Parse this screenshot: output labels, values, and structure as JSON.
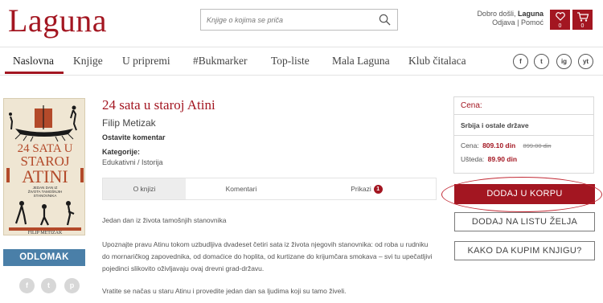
{
  "header": {
    "logo": "Laguna",
    "search_placeholder": "Knjige o kojima se priča",
    "greeting_prefix": "Dobro došli,",
    "greeting_brand": "Laguna",
    "account_links": "Odjava | Pomoć",
    "wishlist_count": "0",
    "cart_count": "0"
  },
  "nav": {
    "items": [
      "Naslovna",
      "Knjige",
      "U pripremi",
      "#Bukmarker",
      "Top-liste",
      "Mala Laguna",
      "Klub čitalaca"
    ],
    "active": "Naslovna",
    "social": [
      "f",
      "t",
      "ig",
      "yt"
    ]
  },
  "book": {
    "cover": {
      "line1": "24 SATA U",
      "line2": "STAROJ",
      "line3": "ATINI",
      "subtitle1": "JEDAN DAN IZ",
      "subtitle2": "ŽIVOTA TAMOŠNJIH",
      "subtitle3": "STANOVNIKA",
      "author": "FILIP METIZAK"
    },
    "title": "24 sata u staroj Atini",
    "author": "Filip Metizak",
    "comment_link": "Ostavite komentar",
    "categories_label": "Kategorije:",
    "categories": "Edukativni / Istorija",
    "excerpt_button": "ODLOMAK"
  },
  "tabs": {
    "items": [
      "O knjizi",
      "Komentari",
      "Prikazi"
    ],
    "reviews_badge": "1"
  },
  "description": [
    "Jedan dan iz života tamošnjih stanovnika",
    "Upoznajte pravu Atinu tokom uzbudljiva dvadeset četiri sata iz života njegovih stanovnika: od roba u rudniku do mornaričkog zapovednika, od domaćice do hoplita, od kurtizane do krijumčara smokava – svi tu upečatljivi pojedinci slikovito oživljavaju ovaj drevni grad-državu.",
    "Vratite se načas u staru Atinu i provedite jedan dan sa ljudima koji su tamo živeli."
  ],
  "price": {
    "header": "Cena:",
    "region": "Srbija i ostale države",
    "price_label": "Cena:",
    "price_value": "809.10 din",
    "old_price": "899.00 din",
    "savings_label": "Ušteda:",
    "savings_value": "89.90 din"
  },
  "buttons": {
    "add_to_cart": "DODAJ U KORPU",
    "add_to_wishlist": "DODAJ NA LISTU ŽELJA",
    "how_to_buy": "KAKO DA KUPIM KNJIGU?"
  },
  "colors": {
    "brand_red": "#a31621",
    "excerpt_blue": "#4a7fa8"
  }
}
